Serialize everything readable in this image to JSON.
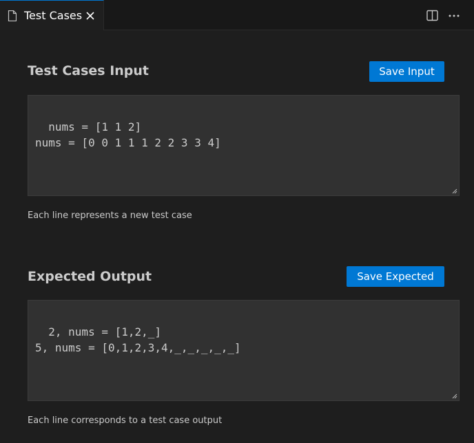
{
  "tab": {
    "label": "Test Cases",
    "file_icon": "file-icon",
    "close_icon": "close-icon"
  },
  "editor_actions": {
    "split_icon": "split-editor-icon",
    "more_icon": "more-actions-icon"
  },
  "input_section": {
    "title": "Test Cases Input",
    "save_label": "Save Input",
    "content": "nums = [1 1 2]\nnums = [0 0 1 1 1 2 2 3 3 4]",
    "hint": "Each line represents a new test case"
  },
  "output_section": {
    "title": "Expected Output",
    "save_label": "Save Expected",
    "content": "2, nums = [1,2,_]\n5, nums = [0,1,2,3,4,_,_,_,_,_]",
    "hint": "Each line corresponds to a test case output"
  },
  "colors": {
    "background": "#1e1e1e",
    "button": "#0078d4",
    "textarea": "#313131"
  }
}
